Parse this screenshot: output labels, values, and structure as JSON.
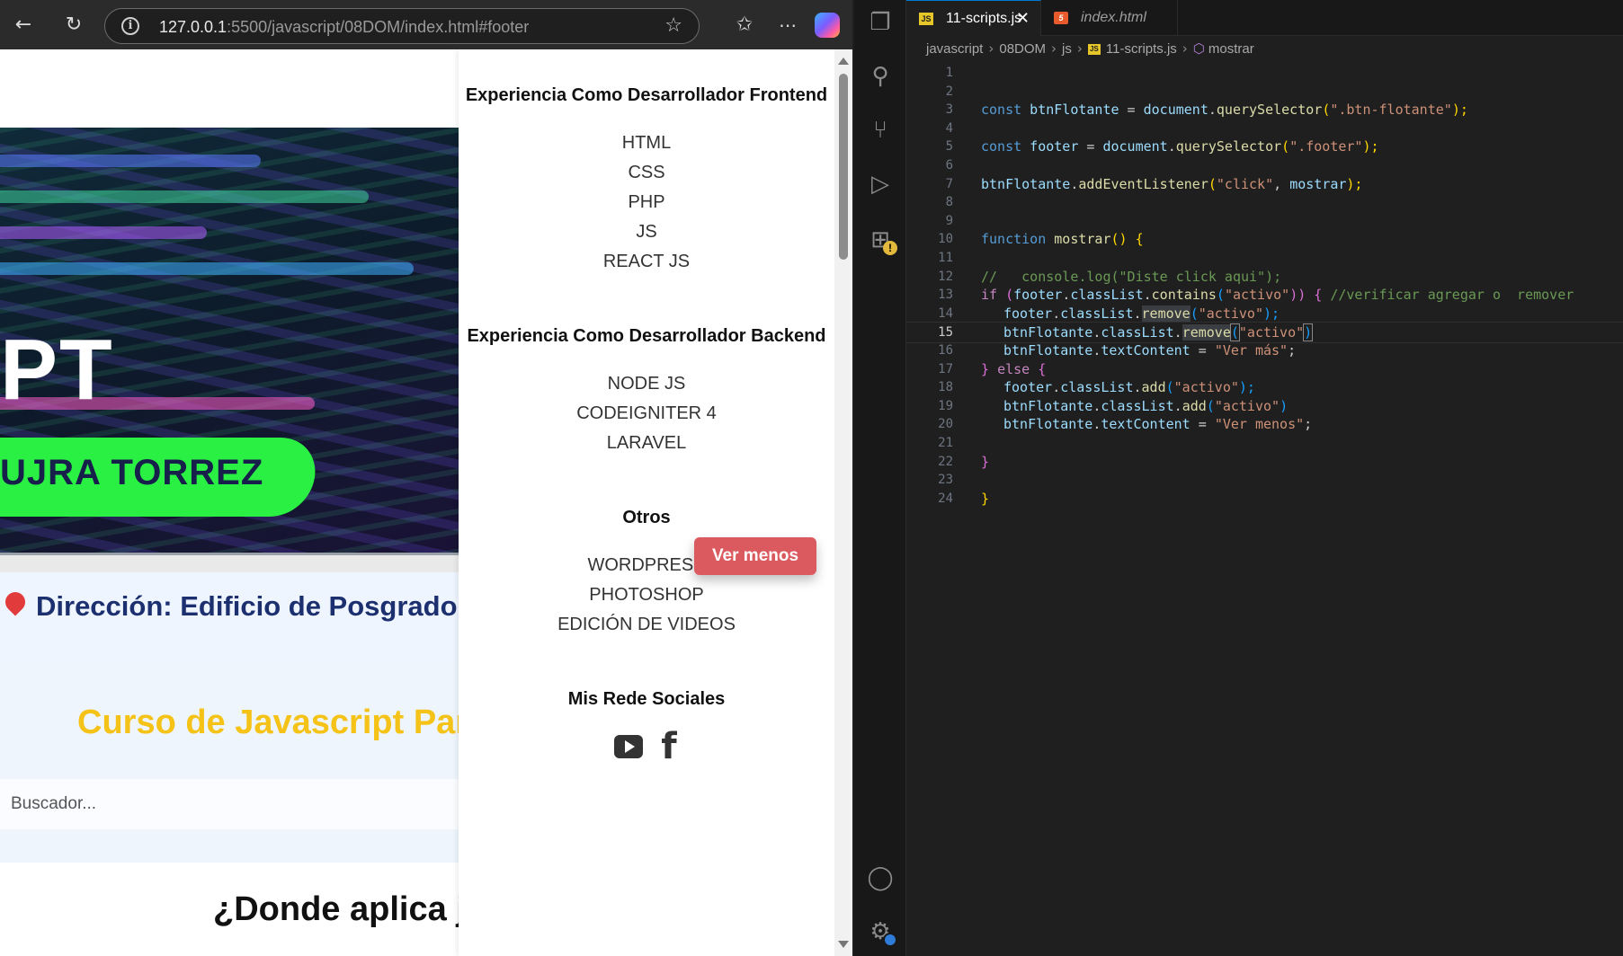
{
  "browser": {
    "back_icon": "arrow-left-icon",
    "reload_icon": "reload-icon",
    "url_host": "127.0.0.1",
    "url_rest": ":5500/javascript/08DOM/index.html#footer",
    "page": {
      "banner_text_big": "PT",
      "banner_text_green": "UJRA TORREZ",
      "address_line": "Dirección: Edificio de Posgrado",
      "course_title": "Curso de Javascript Para",
      "search_placeholder": "Buscador...",
      "section_title": "¿Donde aplica ja"
    },
    "footer": {
      "frontend_title": "Experiencia Como Desarrollador Frontend",
      "frontend_items": [
        "HTML",
        "CSS",
        "PHP",
        "JS",
        "REACT JS"
      ],
      "backend_title": "Experiencia Como Desarrollador Backend",
      "backend_items": [
        "NODE JS",
        "CODEIGNITER 4",
        "LARAVEL"
      ],
      "otros_title": "Otros",
      "otros_items": [
        "WORDPRESS",
        "PHOTOSHOP",
        "EDICIÓN DE VIDEOS"
      ],
      "social_title": "Mis Rede Sociales",
      "social_icons": [
        "youtube-icon",
        "facebook-icon"
      ]
    },
    "floating_button": "Ver menos",
    "floating_button_color": "#db5a5f"
  },
  "vscode": {
    "tabs": [
      {
        "label": "11-scripts.js",
        "icon": "JS",
        "active": true
      },
      {
        "label": "index.html",
        "icon": "5",
        "active": false
      }
    ],
    "breadcrumb": [
      "javascript",
      "08DOM",
      "js",
      "11-scripts.js",
      "mostrar"
    ],
    "current_line": 15,
    "line_numbers": [
      "1",
      "2",
      "3",
      "4",
      "5",
      "6",
      "7",
      "8",
      "9",
      "10",
      "11",
      "12",
      "13",
      "14",
      "15",
      "16",
      "17",
      "18",
      "19",
      "20",
      "21",
      "22",
      "23",
      "24"
    ],
    "code": {
      "l3": [
        "const",
        " btnFlotante",
        " = ",
        "document",
        ".",
        "querySelector",
        "(",
        "\".btn-flotante\"",
        ");"
      ],
      "l5": [
        "const",
        " footer",
        " = ",
        "document",
        ".",
        "querySelector",
        "(",
        "\".footer\"",
        ");"
      ],
      "l7": [
        "btnFlotante",
        ".",
        "addEventListener",
        "(",
        "\"click\"",
        ", ",
        "mostrar",
        ");"
      ],
      "l10": [
        "function",
        " ",
        "mostrar",
        "()",
        " ",
        "{"
      ],
      "l12": "//   console.log(\"Diste click aqui\");",
      "l13": [
        "if",
        " ",
        "(",
        "footer",
        ".",
        "classList",
        ".",
        "contains",
        "(",
        "\"activo\"",
        "))",
        " ",
        "{",
        " ",
        "//verificar agregar o  remover"
      ],
      "l14": [
        "footer",
        ".",
        "classList",
        ".",
        "remove",
        "(",
        "\"activo\"",
        ");"
      ],
      "l15": [
        "btnFlotante",
        ".",
        "classList",
        ".",
        "remove",
        "(",
        "\"activo\"",
        ")"
      ],
      "l16": [
        "btnFlotante",
        ".",
        "textContent",
        " = ",
        "\"Ver más\"",
        ";"
      ],
      "l17": [
        "}",
        " ",
        "else",
        " ",
        "{"
      ],
      "l18": [
        "footer",
        ".",
        "classList",
        ".",
        "add",
        "(",
        "\"activo\"",
        ");"
      ],
      "l19": [
        "btnFlotante",
        ".",
        "classList",
        ".",
        "add",
        "(",
        "\"activo\"",
        ")"
      ],
      "l20": [
        "btnFlotante",
        ".",
        "textContent",
        " = ",
        "\"Ver menos\"",
        ";"
      ],
      "l22": "}",
      "l24": "}"
    },
    "activity_icons": [
      "explorer-icon",
      "search-icon",
      "source-control-icon",
      "run-debug-icon",
      "extensions-icon",
      "account-icon",
      "settings-icon"
    ]
  }
}
